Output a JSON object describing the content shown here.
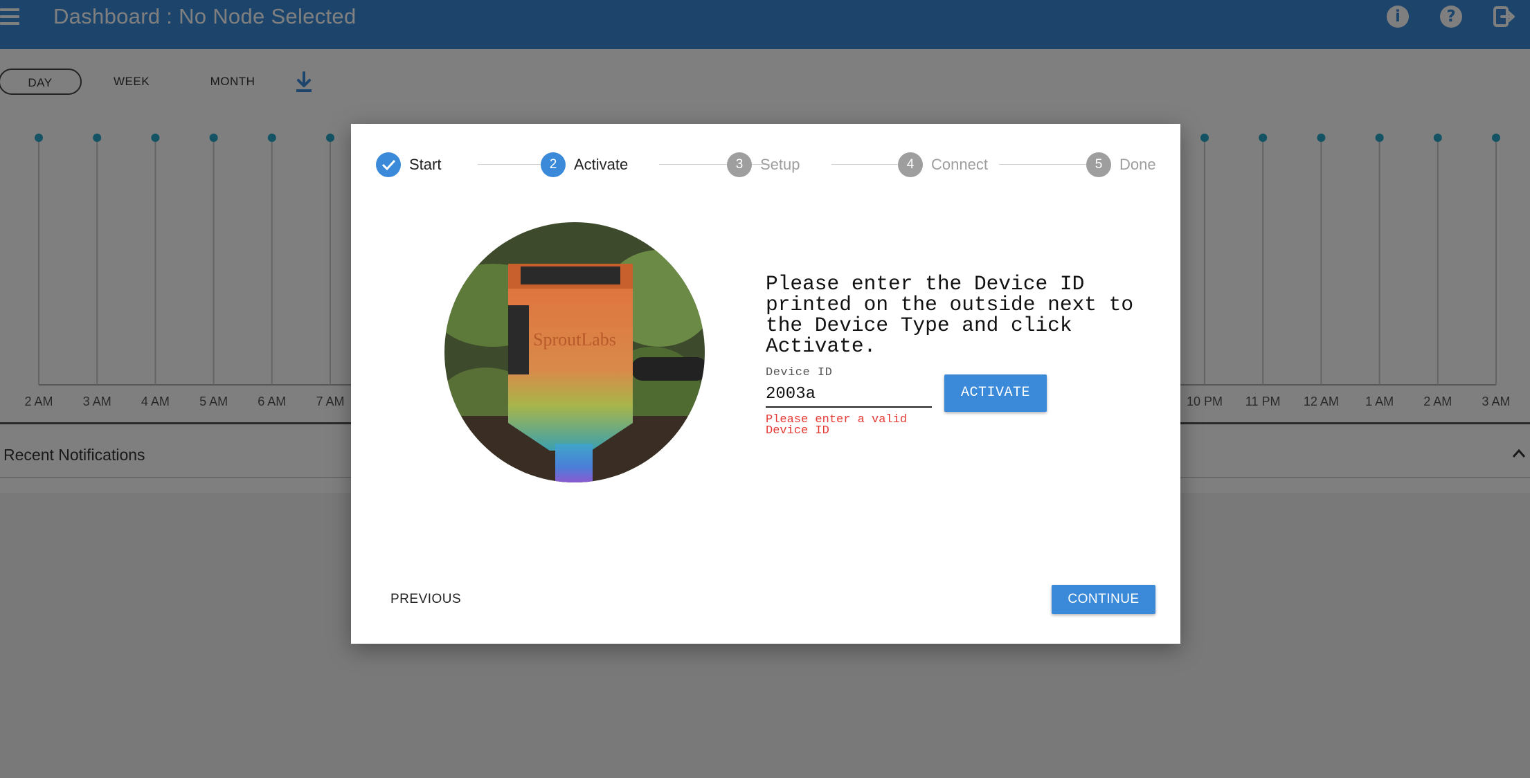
{
  "header": {
    "title": "Dashboard : No Node Selected",
    "icons": [
      "menu-icon",
      "info-icon",
      "help-icon",
      "logout-icon"
    ],
    "info_glyph": "i",
    "help_glyph": "?"
  },
  "toolbar": {
    "ranges": [
      "DAY",
      "WEEK",
      "MONTH"
    ],
    "selected_range": "DAY",
    "download_icon": "download-icon"
  },
  "chart_data": {
    "type": "scatter",
    "x_ticks_left": [
      "2 AM",
      "3 AM",
      "4 AM",
      "5 AM",
      "6 AM",
      "7 AM"
    ],
    "x_ticks_right": [
      "10 PM",
      "11 PM",
      "12 AM",
      "1 AM",
      "2 AM",
      "3 AM"
    ],
    "points_visible": 26,
    "title": "",
    "xlabel": "",
    "ylabel": "",
    "grid": "vertical",
    "point_color": "#26a6c8"
  },
  "notifications": {
    "title": "Recent Notifications",
    "collapse_icon": "chevron-up-icon"
  },
  "modal": {
    "steps": [
      {
        "number": "",
        "label": "Start",
        "state": "complete"
      },
      {
        "number": "2",
        "label": "Activate",
        "state": "active"
      },
      {
        "number": "3",
        "label": "Setup",
        "state": "pending"
      },
      {
        "number": "4",
        "label": "Connect",
        "state": "pending"
      },
      {
        "number": "5",
        "label": "Done",
        "state": "pending"
      }
    ],
    "image_brand_text": "SproutLabs",
    "instructions": "Please enter the Device ID printed on the outside next to the Device Type and click Activate.",
    "device_id": {
      "label": "Device ID",
      "value": "2003a",
      "error": "Please enter a valid Device ID"
    },
    "activate_label": "ACTIVATE",
    "previous_label": "PREVIOUS",
    "continue_label": "CONTINUE"
  },
  "colors": {
    "primary": "#3b8ad9",
    "error": "#e53935",
    "step_pending": "#9e9e9e"
  }
}
